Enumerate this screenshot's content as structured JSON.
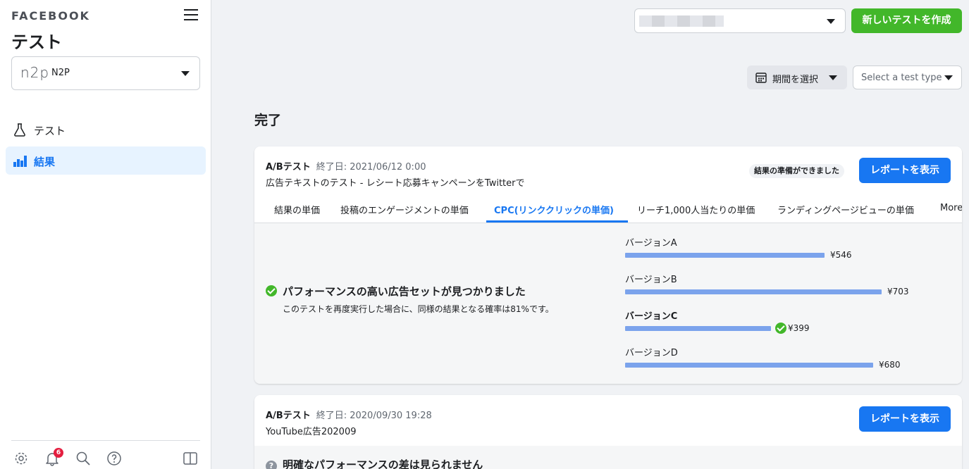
{
  "sidebar": {
    "brand": "FACEBOOK",
    "title": "テスト",
    "account": {
      "logo": "n2p",
      "name": "N2P"
    },
    "nav": [
      {
        "label": "テスト",
        "icon": "flask-icon"
      },
      {
        "label": "結果",
        "icon": "bar-chart-icon",
        "active": true
      }
    ],
    "footer_icons": [
      "gear-icon",
      "bell-icon",
      "search-icon",
      "help-icon",
      "panel-toggle-icon"
    ],
    "notification_count": "6"
  },
  "header": {
    "create_button": "新しいテストを作成"
  },
  "filters": {
    "period_label": "期間を選択",
    "test_type_placeholder": "Select a test type"
  },
  "section_title": "完了",
  "tests": [
    {
      "type": "A/Bテスト",
      "end_date": "終了日: 2021/06/12 0:00",
      "name": "広告テキストのテスト - レシート応募キャンペーンをTwitterで",
      "status": "結果の準備ができました",
      "report_button": "レポートを表示",
      "tabs": [
        "結果の単価",
        "投稿のエンゲージメントの単価",
        "CPC(リンククリックの単価)",
        "リーチ1,000人当たりの単価",
        "ランディングページビューの単価",
        "More"
      ],
      "active_tab": 2,
      "result_title": "パフォーマンスの高い広告セットが見つかりました",
      "result_desc": "このテストを再度実行した場合に、同様の結果となる確率は81%です。",
      "versions": [
        {
          "label": "バージョンA",
          "value": "¥546",
          "amount": 546
        },
        {
          "label": "バージョンB",
          "value": "¥703",
          "amount": 703
        },
        {
          "label": "バージョンC",
          "value": "¥399",
          "amount": 399,
          "winner": true
        },
        {
          "label": "バージョンD",
          "value": "¥680",
          "amount": 680
        }
      ]
    },
    {
      "type": "A/Bテスト",
      "end_date": "終了日: 2020/09/30 19:28",
      "name": "YouTube広告202009",
      "report_button": "レポートを表示",
      "result_title": "明確なパフォーマンスの差は見られません"
    }
  ],
  "colors": {
    "primary": "#1877f2",
    "green": "#42b72a",
    "bar": "#7ba3ec"
  }
}
